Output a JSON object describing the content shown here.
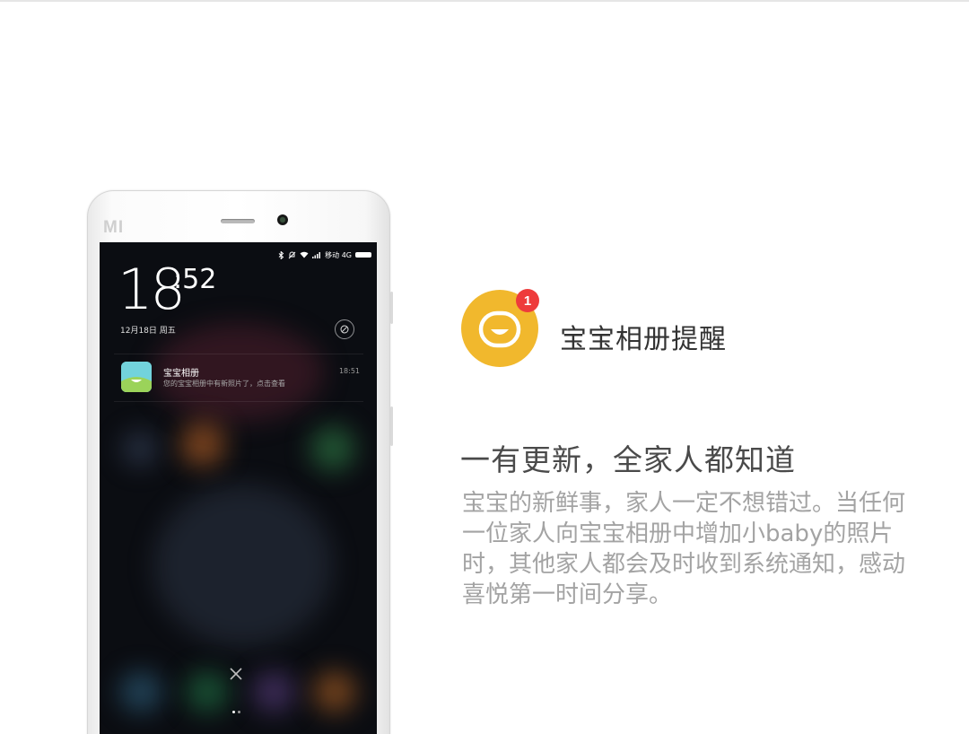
{
  "status_bar": {
    "carrier": "移动 4G"
  },
  "lockscreen": {
    "hour": "18",
    "minute": ":52",
    "date": "12月18日 周五"
  },
  "notification": {
    "app_name": "宝宝相册",
    "message": "您的宝宝相册中有新照片了，点击查看",
    "time": "18:51"
  },
  "phone": {
    "brand_logo": "MI"
  },
  "feature": {
    "badge_count": "1",
    "title": "宝宝相册提醒",
    "headline": "一有更新，全家人都知道",
    "description": "宝宝的新鲜事，家人一定不想错过。当任何一位家人向宝宝相册中增加小baby的照片时，其他家人都会及时收到系统通知，感动喜悦第一时间分享。"
  },
  "colors": {
    "icon_yellow": "#f1b82d",
    "badge_red": "#ee3b3b",
    "title_text": "#333333",
    "description_text": "#a3a3a3"
  },
  "icons": [
    "bluetooth-icon",
    "silent-icon",
    "wifi-icon",
    "signal-icon",
    "battery-icon",
    "do-not-disturb-icon",
    "close-icon",
    "smile-icon"
  ]
}
